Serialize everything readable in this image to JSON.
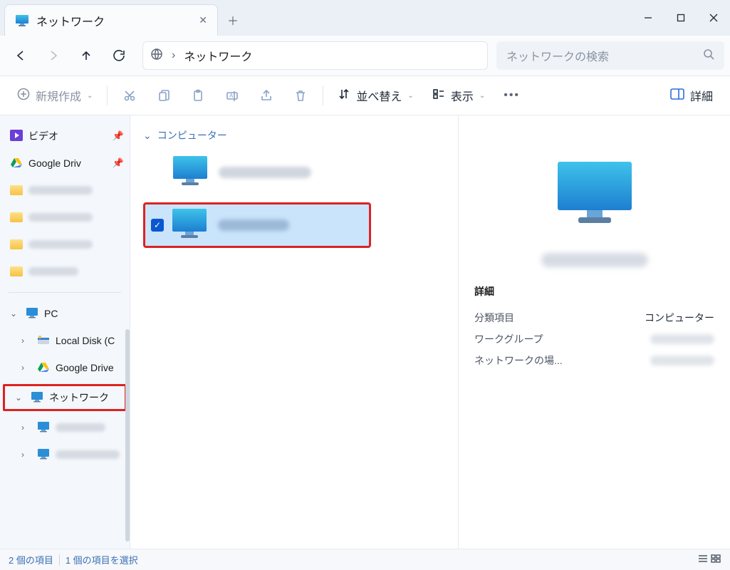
{
  "window": {
    "tab_title": "ネットワーク"
  },
  "nav": {
    "address": "ネットワーク",
    "search_placeholder": "ネットワークの検索"
  },
  "toolbar": {
    "new_label": "新規作成",
    "sort_label": "並べ替え",
    "view_label": "表示",
    "details_label": "詳細"
  },
  "sidebar": {
    "video": "ビデオ",
    "gdrive_quick": "Google Driv",
    "pc": "PC",
    "local_disk": "Local Disk (C",
    "gdrive": "Google Drive",
    "network": "ネットワーク"
  },
  "content": {
    "group_label": "コンピューター"
  },
  "details": {
    "section": "詳細",
    "rows": {
      "category_label": "分類項目",
      "category_value": "コンピューター",
      "workgroup_label": "ワークグループ",
      "netloc_label": "ネットワークの場..."
    }
  },
  "status": {
    "items": "2 個の項目",
    "selected": "1 個の項目を選択"
  }
}
